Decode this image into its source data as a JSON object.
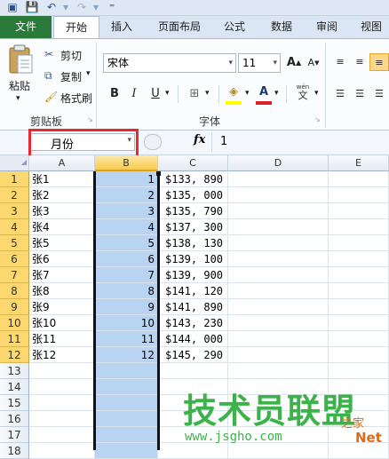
{
  "ribbon_tabs": [
    "文件",
    "开始",
    "插入",
    "页面布局",
    "公式",
    "数据",
    "审阅",
    "视图"
  ],
  "clipboard": {
    "paste": "粘贴",
    "cut": "剪切",
    "copy": "复制",
    "format_painter": "格式刷",
    "group_label": "剪贴板"
  },
  "font": {
    "name": "宋体",
    "size": "11",
    "bold": "B",
    "italic": "I",
    "underline": "U",
    "grow": "A",
    "shrink": "A",
    "group_label": "字体",
    "wen": "wén"
  },
  "formula_bar": {
    "name_box": "月份",
    "fx": "fx",
    "value": "1"
  },
  "columns": [
    "A",
    "B",
    "C",
    "D",
    "E"
  ],
  "rows": [
    {
      "n": "1",
      "a": "张1",
      "b": "1",
      "c": "$133, 890"
    },
    {
      "n": "2",
      "a": "张2",
      "b": "2",
      "c": "$135, 000"
    },
    {
      "n": "3",
      "a": "张3",
      "b": "3",
      "c": "$135, 790"
    },
    {
      "n": "4",
      "a": "张4",
      "b": "4",
      "c": "$137, 300"
    },
    {
      "n": "5",
      "a": "张5",
      "b": "5",
      "c": "$138, 130"
    },
    {
      "n": "6",
      "a": "张6",
      "b": "6",
      "c": "$139, 100"
    },
    {
      "n": "7",
      "a": "张7",
      "b": "7",
      "c": "$139, 900"
    },
    {
      "n": "8",
      "a": "张8",
      "b": "8",
      "c": "$141, 120"
    },
    {
      "n": "9",
      "a": "张9",
      "b": "9",
      "c": "$141, 890"
    },
    {
      "n": "10",
      "a": "张10",
      "b": "10",
      "c": "$143, 230"
    },
    {
      "n": "11",
      "a": "张11",
      "b": "11",
      "c": "$144, 000"
    },
    {
      "n": "12",
      "a": "张12",
      "b": "12",
      "c": "$145, 290"
    },
    {
      "n": "13",
      "a": "",
      "b": "",
      "c": ""
    },
    {
      "n": "14",
      "a": "",
      "b": "",
      "c": ""
    },
    {
      "n": "15",
      "a": "",
      "b": "",
      "c": ""
    },
    {
      "n": "16",
      "a": "",
      "b": "",
      "c": ""
    },
    {
      "n": "17",
      "a": "",
      "b": "",
      "c": ""
    },
    {
      "n": "18",
      "a": "",
      "b": "",
      "c": ""
    }
  ],
  "watermark": {
    "title": "技术员联盟",
    "url": "www.jsgho.com",
    "net": "Net",
    "tag": "之家"
  },
  "colors": {
    "file_tab": "#2a7a3a",
    "selection": "#b8d4f2",
    "row_header_selected": "#fdd870",
    "highlight_box": "#e8292e",
    "watermark_green": "#3cb34a"
  },
  "icons": {
    "save": "save-icon",
    "undo": "undo-icon",
    "redo": "redo-icon",
    "paste": "clipboard-icon",
    "cut": "scissors-icon",
    "copy": "copy-icon",
    "format_painter": "brush-icon"
  }
}
